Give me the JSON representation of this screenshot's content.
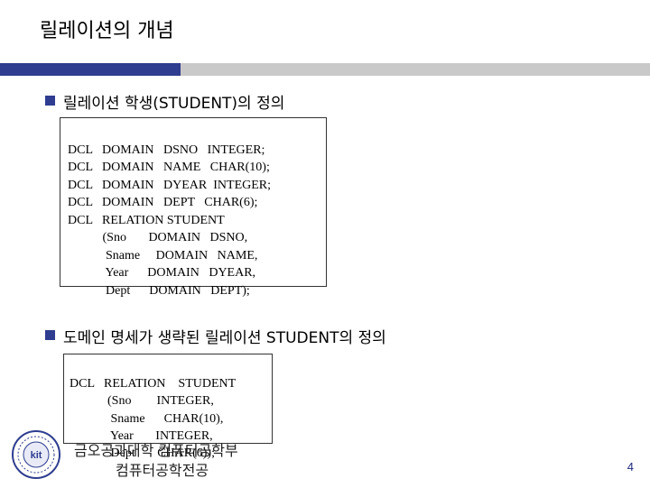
{
  "slide": {
    "title": "릴레이션의 개념",
    "page_number": "4"
  },
  "section1": {
    "heading": "릴레이션 학생(STUDENT)의 정의",
    "lines": [
      "DCL   DOMAIN   DSNO   INTEGER;",
      "DCL   DOMAIN   NAME   CHAR(10);",
      "DCL   DOMAIN   DYEAR  INTEGER;",
      "DCL   DOMAIN   DEPT   CHAR(6);",
      "DCL   RELATION STUDENT",
      "           (Sno       DOMAIN   DSNO,",
      "            Sname     DOMAIN   NAME,",
      "            Year      DOMAIN   DYEAR,",
      "            Dept      DOMAIN   DEPT);"
    ]
  },
  "section2": {
    "heading": "도메인 명세가 생략된 릴레이션 STUDENT의 정의",
    "lines": [
      "DCL   RELATION    STUDENT",
      "            (Sno        INTEGER,",
      "             Sname      CHAR(10),",
      "             Year       INTEGER,",
      "             Dept       CHAR(6));"
    ]
  },
  "footer": {
    "line1": "금오공과대학 컴퓨터공학부",
    "line2": "컴퓨터공학전공"
  },
  "logo": {
    "icon": "university-seal-icon",
    "text": "kit"
  },
  "colors": {
    "accent": "#2e3d8f",
    "rule_light": "#c9c9c9"
  }
}
